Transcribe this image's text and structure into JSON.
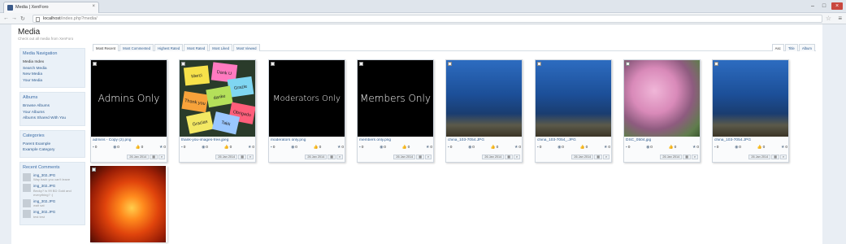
{
  "browser": {
    "tab_title": "Media | XenForo",
    "url_host": "localhost",
    "url_path": "/index.php?media/"
  },
  "page": {
    "title": "Media",
    "subtitle": "Check out all media from XenForo"
  },
  "sidebar": {
    "media_nav": {
      "title": "Media Navigation",
      "items": [
        "Media Index",
        "Search Media",
        "New Media",
        "Your Media"
      ]
    },
    "albums": {
      "title": "Albums",
      "items": [
        "Browse Albums",
        "Your Albums",
        "Albums Shared With You"
      ]
    },
    "categories": {
      "title": "Categories",
      "items": [
        "Parent Example",
        "Example Category"
      ]
    },
    "recent_comments": {
      "title": "Recent Comments",
      "items": [
        {
          "name": "img_302.JPG",
          "text": "Way back you can't leave"
        },
        {
          "name": "img_302.JPG",
          "text": "Becky? is 99 BD Gold and everything? :)"
        },
        {
          "name": "img_302.JPG",
          "text": "wait sat"
        },
        {
          "name": "img_302.JPG",
          "text": "test test"
        }
      ]
    }
  },
  "sort_tabs": [
    "Most Recent",
    "Most Commented",
    "Highest Rated",
    "Most Rated",
    "Most Liked",
    "Most Viewed"
  ],
  "order_tabs": [
    "Asc",
    "Title",
    "Album"
  ],
  "media": [
    {
      "name": "admins - Copy (2).png",
      "overlay": "Admins Only",
      "style": "black",
      "stats": [
        "0",
        "0",
        "0",
        "0"
      ],
      "date": "26 Jan 2014"
    },
    {
      "name": "thank-you-images-free.jpeg",
      "overlay": "",
      "style": "notes",
      "stats": [
        "0",
        "0",
        "0",
        "0"
      ],
      "date": "26 Jan 2014"
    },
    {
      "name": "moderators only.png",
      "overlay": "Moderators Only",
      "style": "black",
      "stats": [
        "0",
        "0",
        "0",
        "0"
      ],
      "date": "26 Jan 2014"
    },
    {
      "name": "members only.png",
      "overlay": "Members Only",
      "style": "black",
      "stats": [
        "0",
        "0",
        "0",
        "0"
      ],
      "date": "26 Jan 2014"
    },
    {
      "name": "china_103-7054.JPG",
      "overlay": "",
      "style": "ocean",
      "stats": [
        "0",
        "0",
        "0",
        "0"
      ],
      "date": "26 Jan 2014"
    },
    {
      "name": "china_103-7054_.JPG",
      "overlay": "",
      "style": "ocean",
      "stats": [
        "0",
        "0",
        "0",
        "0"
      ],
      "date": "26 Jan 2014"
    },
    {
      "name": "DSC_0504.jpg",
      "overlay": "",
      "style": "flowers",
      "stats": [
        "0",
        "0",
        "0",
        "0"
      ],
      "date": "26 Jan 2014"
    },
    {
      "name": "china_103-7054.JPG",
      "overlay": "",
      "style": "ocean",
      "stats": [
        "0",
        "0",
        "0",
        "0"
      ],
      "date": "26 Jan 2014"
    },
    {
      "name": "",
      "overlay": "",
      "style": "orange",
      "stats": [],
      "date": ""
    }
  ],
  "sticky_notes": [
    "Merci",
    "Dank U",
    "Grazie",
    "Thank you",
    "danke",
    "Obrigado",
    "Gracias",
    "Takk"
  ]
}
